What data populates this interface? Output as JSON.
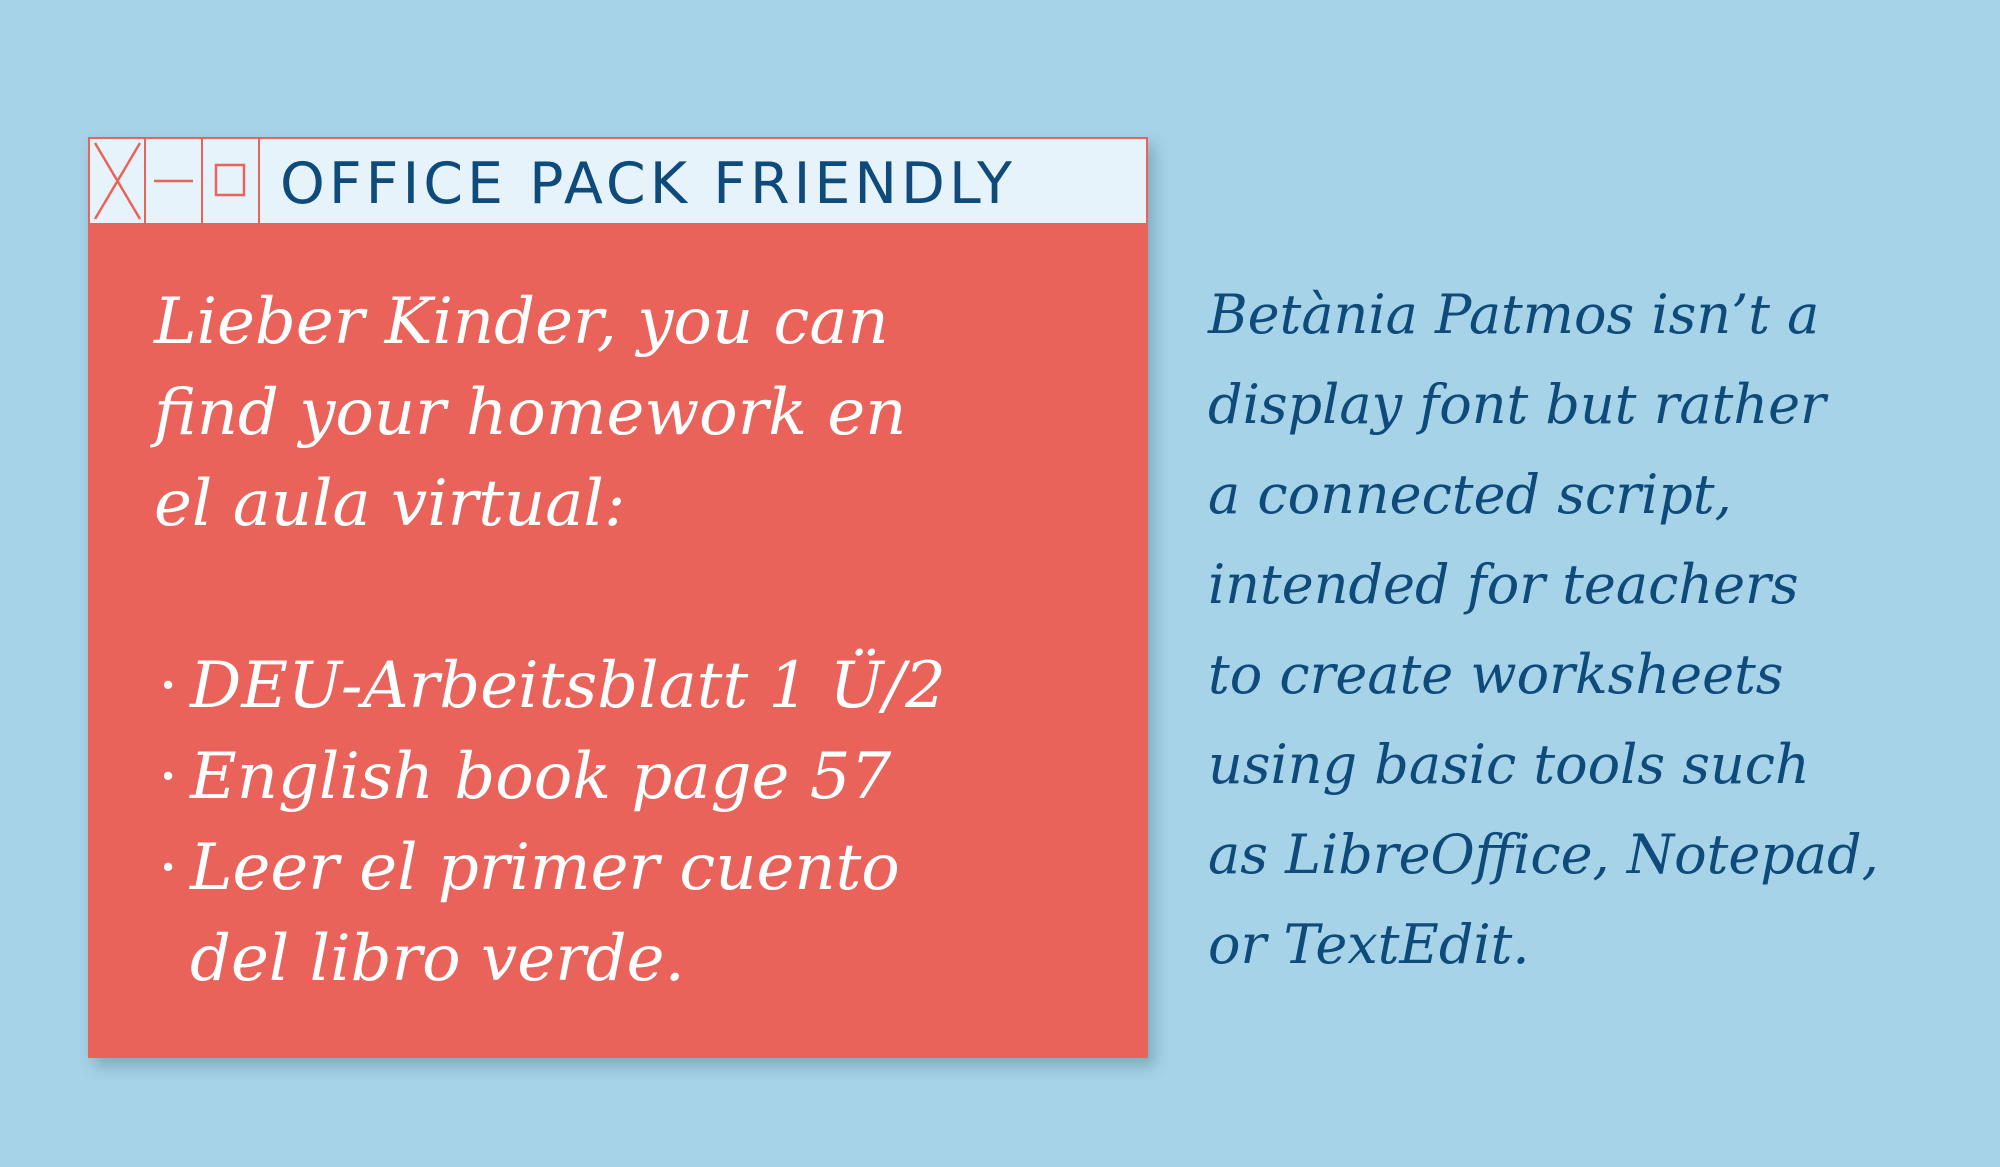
{
  "window": {
    "title": "OFFICE PACK FRIENDLY",
    "controls": [
      "close-icon",
      "minimize-icon",
      "maximize-icon"
    ],
    "message_lines": [
      "Lieber Kinder, you can",
      "find your homework en",
      "el aula virtual:"
    ],
    "todo_items": [
      {
        "bullet": "·",
        "lines": [
          "DEU-Arbeitsblatt 1 Ü/2"
        ]
      },
      {
        "bullet": "·",
        "lines": [
          "English book page 57"
        ]
      },
      {
        "bullet": "·",
        "lines": [
          "Leer el primer cuento",
          "del libro verde."
        ]
      }
    ]
  },
  "description_lines": [
    "Betània Patmos  isn’t a",
    "display font but rather",
    "a connected script,",
    "intended for teachers",
    "to create worksheets",
    "using basic tools such",
    "as LibreOffice, Notepad,",
    "or TextEdit."
  ],
  "colors": {
    "background": "#a6d3e8",
    "window": "#e9635a",
    "titlebar": "#e6f3fb",
    "accent_text": "#0e4a7a"
  }
}
